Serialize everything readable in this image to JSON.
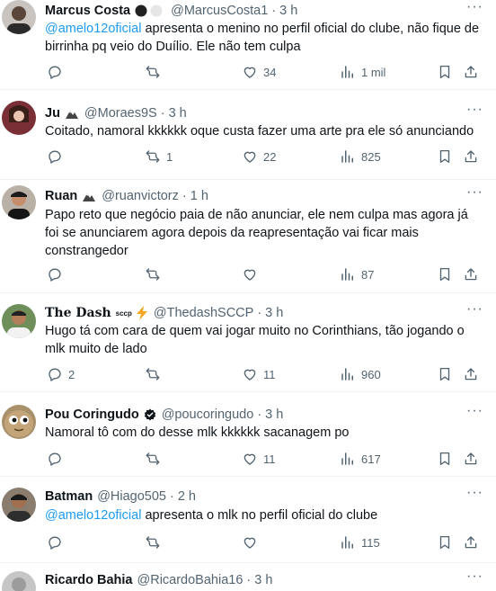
{
  "tweets": [
    {
      "name": "Marcus Costa",
      "badge": "● ●",
      "handle": "@MarcusCosta1",
      "time": "3 h",
      "mention": "@amelo12oficial",
      "text": " apresenta o menino no perfil oficial do clube, não fique de birrinha pq veio do Duílio. Ele não tem culpa",
      "replies": "",
      "retweets": "",
      "likes": "34",
      "views": "1 mil"
    },
    {
      "name": "Ju",
      "badge": "🏔",
      "handle": "@Moraes9S",
      "time": "3 h",
      "mention": "",
      "text": "Coitado, namoral kkkkkk oque custa fazer uma arte pra ele só anunciando",
      "replies": "",
      "retweets": "1",
      "likes": "22",
      "views": "825"
    },
    {
      "name": "Ruan",
      "badge": "🏔",
      "handle": "@ruanvictorz",
      "time": "1 h",
      "mention": "",
      "text": "Papo reto que negócio paia de não anunciar, ele nem culpa mas agora já foi se anunciarem agora depois da reapresentação vai ficar mais constrangedor",
      "replies": "",
      "retweets": "",
      "likes": "",
      "views": "87"
    },
    {
      "name": "The Dash",
      "badge": "sccp ⚡",
      "handle": "@ThedashSCCP",
      "time": "3 h",
      "mention": "",
      "text": "Hugo tá com cara de quem vai jogar muito no Corinthians, tão jogando o mlk muito de lado",
      "replies": "2",
      "retweets": "",
      "likes": "11",
      "views": "960"
    },
    {
      "name": "Pou Coringudo",
      "badge": "✪",
      "handle": "@poucoringudo",
      "time": "3 h",
      "mention": "",
      "text": "Namoral tô com do desse mlk kkkkkk sacanagem po",
      "replies": "",
      "retweets": "",
      "likes": "11",
      "views": "617"
    },
    {
      "name": "Batman",
      "badge": "",
      "handle": "@Hiago505",
      "time": "2 h",
      "mention": "@amelo12oficial",
      "text": " apresenta o mlk no perfil oficial do clube",
      "replies": "",
      "retweets": "",
      "likes": "",
      "views": "115"
    },
    {
      "name": "Ricardo Bahia",
      "badge": "",
      "handle": "@RicardoBahia16",
      "time": "3 h",
      "mention": "",
      "text": "",
      "replies": "",
      "retweets": "",
      "likes": "",
      "views": ""
    }
  ],
  "colors": {
    "text": "#0f1419",
    "muted": "#536471",
    "link": "#1d9bf0",
    "divider": "#eff3f4"
  },
  "icons": [
    "reply-icon",
    "retweet-icon",
    "like-icon",
    "views-icon",
    "bookmark-icon",
    "share-icon",
    "more-icon"
  ]
}
